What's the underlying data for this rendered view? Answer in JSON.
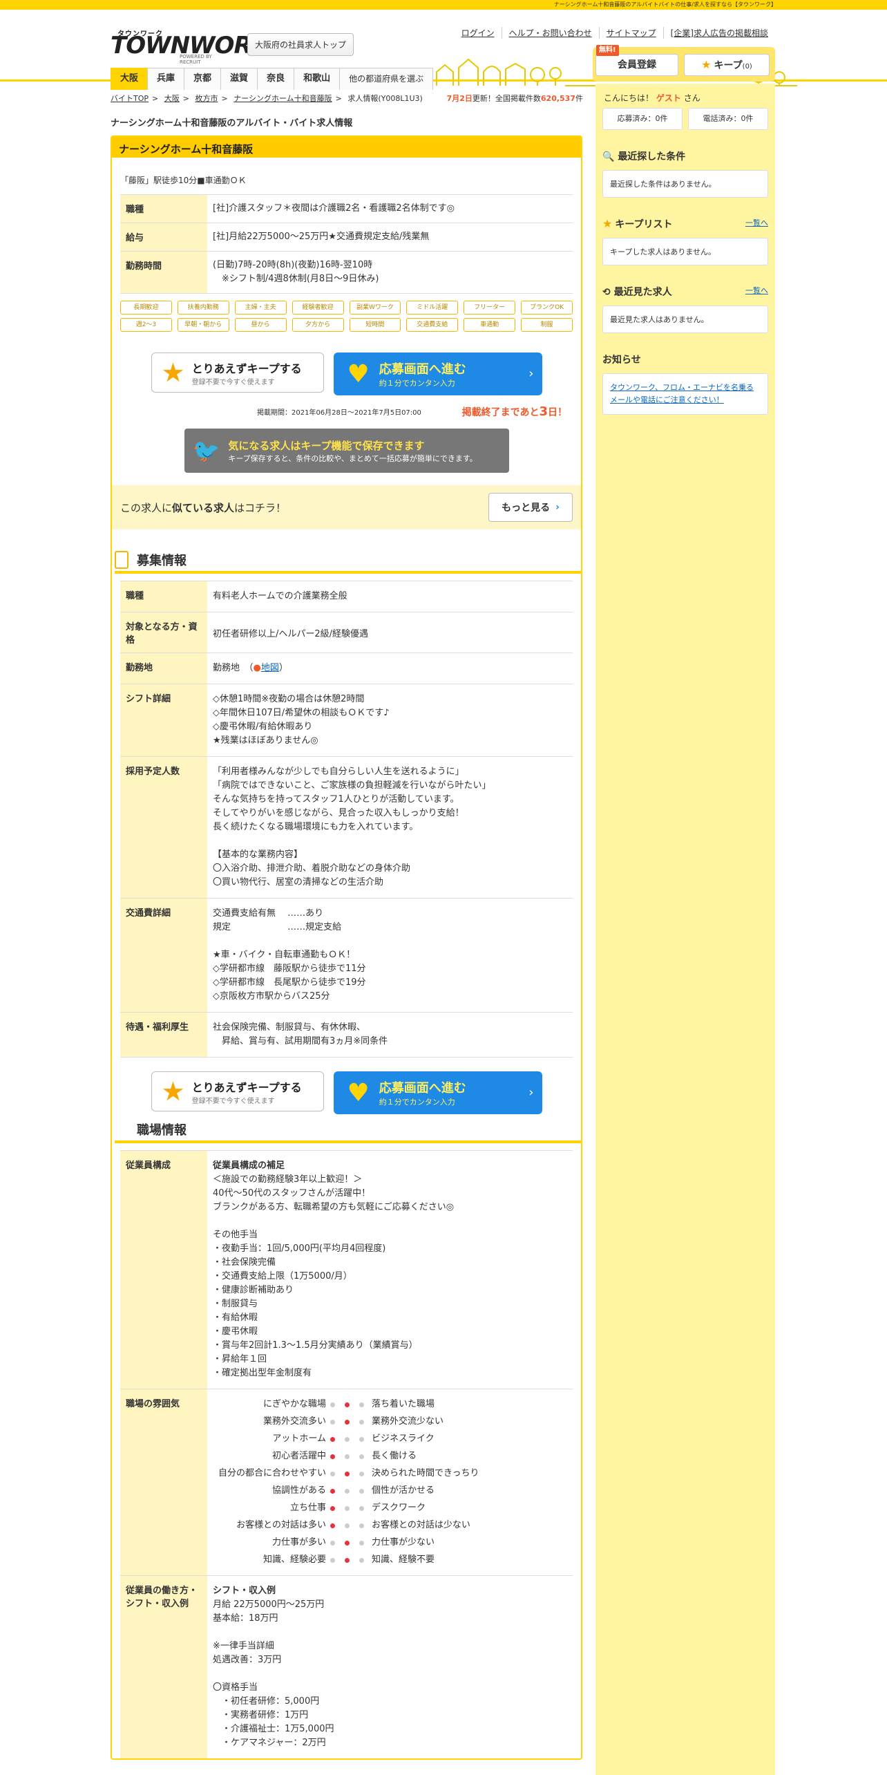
{
  "topbar": {
    "text": "ナーシングホーム十和音藤阪のアルバイトバイトの仕事/求人を探すなら【タウンワーク】"
  },
  "header": {
    "logo_kana": "タウンワーク",
    "logo_main": "TOWNWORK",
    "logo_sub": "POWERED BY RECRUIT",
    "area_top": "大阪府の社員求人トップ",
    "links": [
      "ログイン",
      "ヘルプ・お問い合わせ",
      "サイトマップ",
      "[企業]求人広告の掲載相談"
    ],
    "prefs": [
      "大阪",
      "兵庫",
      "京都",
      "滋賀",
      "奈良",
      "和歌山",
      "他の都道府県を選ぶ"
    ],
    "member_free": "無料!",
    "member": "会員登録",
    "keep": "キープ",
    "keep_count": "(0)"
  },
  "breadcrumb": {
    "items": [
      "バイトTOP",
      "大阪",
      "枚方市",
      "ナーシングホーム十和音藤阪"
    ],
    "current": "求人情報(Y008L1U3)",
    "update_date": "7月2日",
    "update_mid": "更新！全国掲載件数",
    "count": "620,537",
    "unit": "件"
  },
  "page_title": "ナーシングホーム十和音藤阪のアルバイト・バイト求人情報",
  "job": {
    "name": "ナーシングホーム十和音藤阪",
    "catch": "「藤阪」駅徒歩10分■車通勤ＯＫ",
    "rows": [
      {
        "th": "職種",
        "td": "[社]介護スタッフ＊夜間は介護職2名・看護職2名体制です◎"
      },
      {
        "th": "給与",
        "td": "[社]月給22万5000～25万円★交通費規定支給/残業無"
      },
      {
        "th": "勤務時間",
        "td": "(日勤)7時-20時(8h)(夜勤)16時-翌10時\n　※シフト制/4週8休制(月8日～9日休み)"
      }
    ],
    "tags": [
      "長期歓迎",
      "扶養内勤務",
      "主婦・主夫",
      "経験者歓迎",
      "副業Wワーク",
      "ミドル活躍",
      "フリーター",
      "ブランクOK",
      "週2～3",
      "早朝・朝から",
      "昼から",
      "夕方から",
      "短時間",
      "交通費支給",
      "車通勤",
      "制服"
    ],
    "keep_l1": "とりあえずキープする",
    "keep_l2": "登録不要で今すぐ使えます",
    "apply_l1": "応募画面へ進む",
    "apply_l2": "約１分でカンタン入力",
    "period": "掲載期間：2021年06月28日～2021年7月5日07:00",
    "end_pre": "掲載終了まであと",
    "end_days": "3",
    "end_post": "日！",
    "banner_l1": "気になる求人はキープ機能で保存できます",
    "banner_l2": "キープ保存すると、条件の比較や、まとめて一括応募が簡単にできます。",
    "similar_pre": "この求人に",
    "similar_b": "似ている求人",
    "similar_post": "はコチラ！",
    "more": "もっと見る"
  },
  "recruit": {
    "title": "募集情報",
    "rows": [
      {
        "th": "職種",
        "td": "有料老人ホームでの介護業務全般"
      },
      {
        "th": "対象となる方・資格",
        "td": "初任者研修以上/ヘルパー2級/経験優遇"
      },
      {
        "th": "勤務地",
        "td": "勤務地　（",
        "map": "地図",
        "close": "）"
      },
      {
        "th": "シフト詳細",
        "td": "◇休憩1時間※夜勤の場合は休憩2時間\n◇年間休日107日/希望休の相談もＯＫです♪\n◇慶弔休暇/有給休暇あり\n★残業はほぼありません◎"
      },
      {
        "th": "採用予定人数",
        "td": "「利用者様みんなが少しでも自分らしい人生を送れるように」\n「病院ではできないこと、ご家族様の負担軽減を行いながら叶たい」\nそんな気持ちを持ってスタッフ1人ひとりが活動しています。\nそしてやりがいを感じながら、見合った収入もしっかり支給！\n長く続けたくなる職場環境にも力を入れています。\n\n【基本的な業務内容】\n〇入浴介助、排泄介助、着脱介助などの身体介助\n〇買い物代行、居室の清掃などの生活介助"
      },
      {
        "th": "交通費詳細",
        "td": "交通費支給有無　 ……あり\n規定　　　　　　 ……規定支給\n\n★車・バイク・自転車通勤もＯＫ！\n◇学研都市線　藤阪駅から徒歩で11分\n◇学研都市線　長尾駅から徒歩で19分\n◇京阪枚方市駅からバス25分"
      },
      {
        "th": "待遇・福利厚生",
        "td": "社会保険完備、制服貸与、有休休暇、\n　昇給、賞与有、試用期間有3ヵ月※同条件"
      }
    ]
  },
  "workplace": {
    "title": "職場情報",
    "staff_th": "従業員構成",
    "staff_head": "従業員構成の補足",
    "staff_td": "＜施設での勤務経験3年以上歓迎！＞\n40代～50代のスタッフさんが活躍中！\nブランクがある方、転職希望の方も気軽にご応募ください◎\n\nその他手当\n・夜勤手当：1回/5,000円(平均月4回程度)\n・社会保険完備\n・交通費支給上限（1万5000/月）\n・健康診断補助あり\n・制服貸与\n・有給休暇\n・慶弔休暇\n・賞与年2回計1.3～1.5月分実績あり（業績賞与）\n・昇給年１回\n・確定拠出型年金制度有",
    "atm_th": "職場の雰囲気",
    "atmosphere": [
      {
        "l": "にぎやかな職場",
        "r": "落ち着いた職場",
        "pos": 1
      },
      {
        "l": "業務外交流多い",
        "r": "業務外交流少ない",
        "pos": 1
      },
      {
        "l": "アットホーム",
        "r": "ビジネスライク",
        "pos": 0
      },
      {
        "l": "初心者活躍中",
        "r": "長く働ける",
        "pos": 0
      },
      {
        "l": "自分の都合に合わせやすい",
        "r": "決められた時間できっちり",
        "pos": 1
      },
      {
        "l": "協調性がある",
        "r": "個性が活かせる",
        "pos": 0
      },
      {
        "l": "立ち仕事",
        "r": "デスクワーク",
        "pos": 0
      },
      {
        "l": "お客様との対話は多い",
        "r": "お客様との対話は少ない",
        "pos": 0
      },
      {
        "l": "力仕事が多い",
        "r": "力仕事が少ない",
        "pos": 1
      },
      {
        "l": "知識、経験必要",
        "r": "知識、経験不要",
        "pos": 1
      }
    ],
    "shift_th": "従業員の働き方・シフト・収入例",
    "shift_head": "シフト・収入例",
    "shift_td": "月給 22万5000円～25万円\n基本給：18万円\n\n※一律手当詳細\n処遇改善：3万円\n\n〇資格手当\n　・初任者研修：5,000円\n　・実務者研修：1万円\n　・介護福祉士：1万5,000円\n　・ケアマネジャー：2万円"
  },
  "side": {
    "greet_pre": "こんにちは！",
    "guest": "ゲスト",
    "greet_post": "さん",
    "applied": "応募済み：0件",
    "called": "電話済み：0件",
    "recent_search_h": "最近探した条件",
    "recent_search": "最近探した条件はありません。",
    "keeplist_h": "キープリスト",
    "keeplist_link": "一覧へ",
    "keeplist": "キープした求人はありません。",
    "recent_view_h": "最近見た求人",
    "recent_view_link": "一覧へ",
    "recent_view": "最近見た求人はありません。",
    "notice_h": "お知らせ",
    "notice": "タウンワーク、フロム・エーナビを名乗るメールや電話にご注意ください！"
  },
  "colors": {
    "brand": "#ffd400",
    "accent": "#1e8ae6",
    "alert": "#ef5a2a"
  }
}
